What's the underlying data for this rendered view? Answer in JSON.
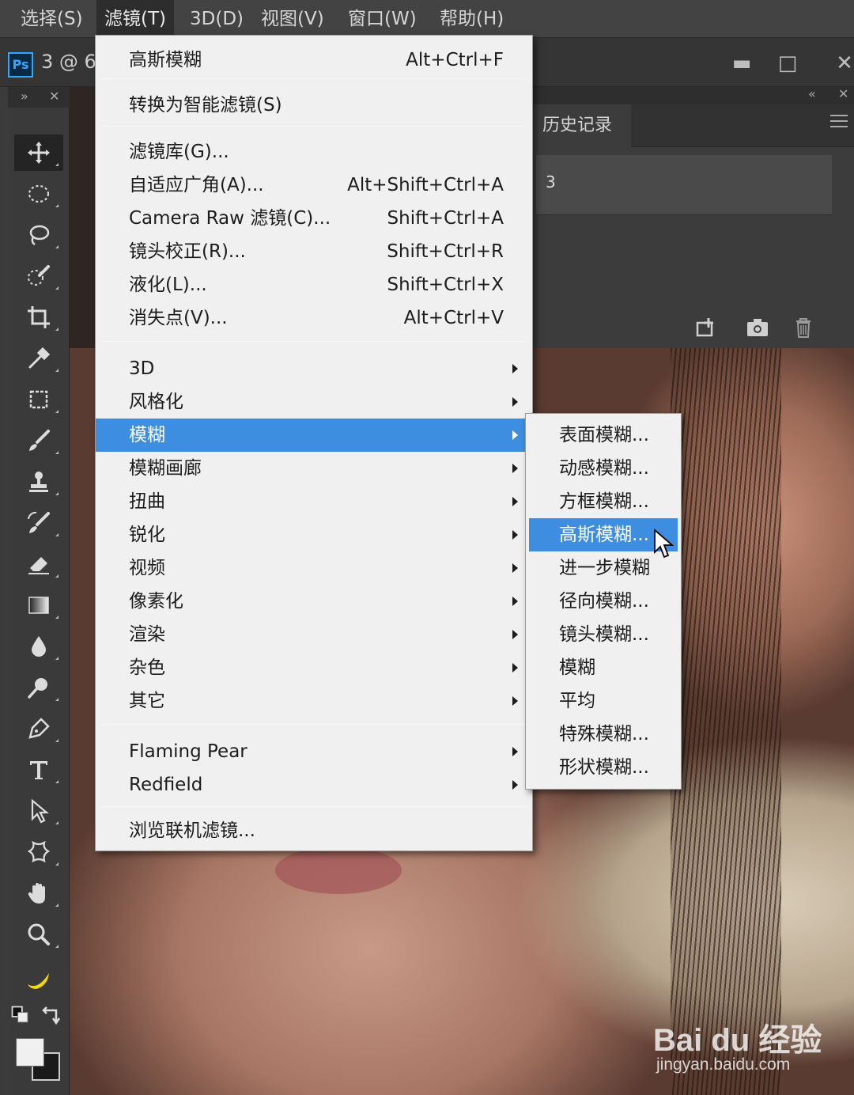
{
  "menubar": {
    "items": [
      "选择(S)",
      "滤镜(T)",
      "3D(D)",
      "视图(V)",
      "窗口(W)",
      "帮助(H)"
    ]
  },
  "document": {
    "tab_title": "3 @ 6"
  },
  "window_controls": {
    "minimize": "▬",
    "restore": "□",
    "close": "✕"
  },
  "filter_menu": {
    "last_filter": {
      "label": "高斯模糊",
      "shortcut": "Alt+Ctrl+F"
    },
    "smart": {
      "label": "转换为智能滤镜(S)"
    },
    "items": [
      {
        "label": "滤镜库(G)...",
        "shortcut": ""
      },
      {
        "label": "自适应广角(A)...",
        "shortcut": "Alt+Shift+Ctrl+A"
      },
      {
        "label": "Camera Raw 滤镜(C)...",
        "shortcut": "Shift+Ctrl+A"
      },
      {
        "label": "镜头校正(R)...",
        "shortcut": "Shift+Ctrl+R"
      },
      {
        "label": "液化(L)...",
        "shortcut": "Shift+Ctrl+X"
      },
      {
        "label": "消失点(V)...",
        "shortcut": "Alt+Ctrl+V"
      }
    ],
    "submenus": [
      "3D",
      "风格化",
      "模糊",
      "模糊画廊",
      "扭曲",
      "锐化",
      "视频",
      "像素化",
      "渲染",
      "杂色",
      "其它"
    ],
    "plugins": [
      "Flaming Pear",
      "Redfield"
    ],
    "browse": "浏览联机滤镜..."
  },
  "blur_menu": {
    "items": [
      "表面模糊...",
      "动感模糊...",
      "方框模糊...",
      "高斯模糊...",
      "进一步模糊",
      "径向模糊...",
      "镜头模糊...",
      "模糊",
      "平均",
      "特殊模糊...",
      "形状模糊..."
    ],
    "highlighted": "高斯模糊..."
  },
  "history_panel": {
    "tab": "历史记录",
    "snapshot_label": "3"
  },
  "watermark": {
    "brand": "Bai du 经验",
    "url": "jingyan.baidu.com"
  },
  "colors": {
    "highlight": "#3d8de0",
    "menu_bg": "#f0f0f0",
    "ps_blue": "#31a8ff"
  }
}
